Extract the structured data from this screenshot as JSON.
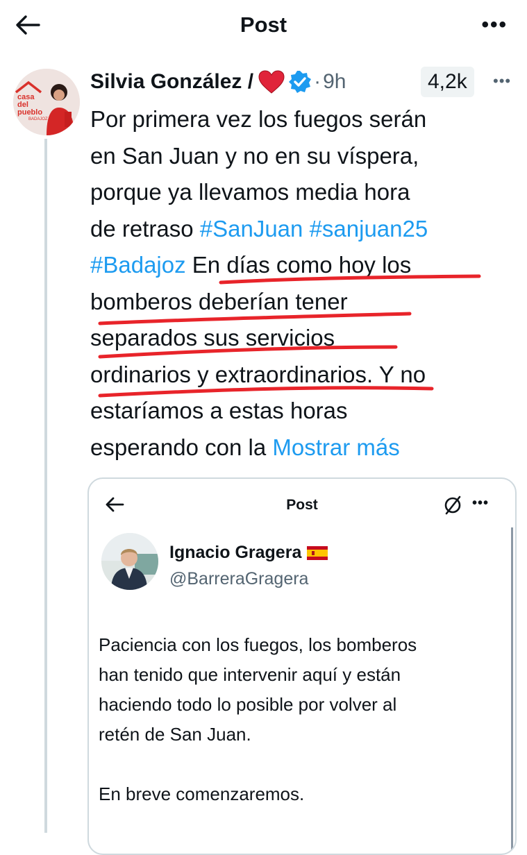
{
  "header": {
    "title": "Post",
    "more_label": "•••"
  },
  "tweet": {
    "author_name": "Silvia González /",
    "time": "9h",
    "views": "4,2k",
    "more_label": "•••",
    "avatar_text": {
      "line1": "casa",
      "line2": "del",
      "line3": "pueblo",
      "line4": "BADAJOZ"
    },
    "lines": {
      "l1": "Por primera vez los fuegos serán",
      "l2": "en San Juan y no en su víspera,",
      "l3": "porque ya llevamos media hora",
      "l4_text": "de retraso ",
      "l4_tag1": "#SanJuan",
      "l4_tag2": "#sanjuan25",
      "l5_tag": "#Badajoz",
      "l5_text": "En días como hoy los",
      "l6": "bomberos deberían tener",
      "l7": "separados sus servicios",
      "l8": "ordinarios y extraordinarios. Y no",
      "l9": "estaríamos a estas horas",
      "l10_text": "esperando con la ",
      "l10_more": "Mostrar más"
    }
  },
  "quote": {
    "title": "Post",
    "more_label": "•••",
    "author_name": "Ignacio Gragera",
    "handle": "@BarreraGragera",
    "p1": {
      "l1": "Paciencia con los fuegos, los bomberos",
      "l2": "han tenido que intervenir aquí y están",
      "l3": "haciendo todo lo posible por volver al",
      "l4": "retén de San Juan."
    },
    "p2": "En breve comenzaremos."
  },
  "colors": {
    "link": "#1d9bf0",
    "verified": "#1d9bf0",
    "heart": "#e0243a",
    "scribble": "#e8242a",
    "muted": "#536471"
  },
  "icons": [
    "back-arrow-icon",
    "more-icon",
    "heart-icon",
    "verified-icon",
    "no-sign-icon",
    "spain-flag-icon"
  ]
}
